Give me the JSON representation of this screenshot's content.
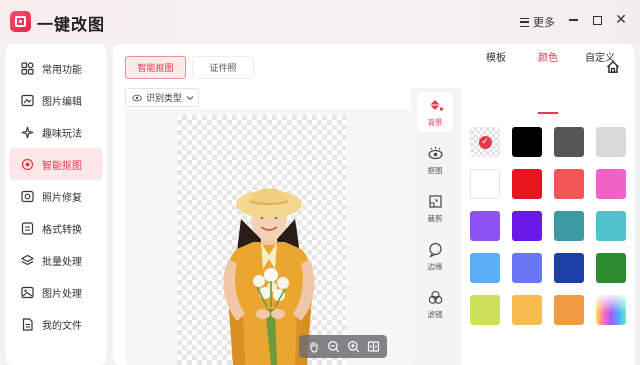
{
  "app": {
    "title": "一键改图",
    "more_label": "更多"
  },
  "sidebar": {
    "items": [
      {
        "label": "常用功能",
        "icon": "grid-icon"
      },
      {
        "label": "图片编辑",
        "icon": "image-edit-icon"
      },
      {
        "label": "趣味玩法",
        "icon": "sparkle-icon"
      },
      {
        "label": "智能抠图",
        "icon": "cutout-icon",
        "active": true
      },
      {
        "label": "照片修复",
        "icon": "repair-icon"
      },
      {
        "label": "格式转换",
        "icon": "convert-icon"
      },
      {
        "label": "批量处理",
        "icon": "layers-icon"
      },
      {
        "label": "图片处理",
        "icon": "picture-icon"
      },
      {
        "label": "我的文件",
        "icon": "file-icon"
      }
    ]
  },
  "main": {
    "tabs": [
      {
        "label": "智能抠图",
        "active": true
      },
      {
        "label": "证件照",
        "active": false
      }
    ],
    "recognize_label": "识别类型"
  },
  "tools": [
    {
      "label": "背景",
      "active": true
    },
    {
      "label": "抠图"
    },
    {
      "label": "裁剪"
    },
    {
      "label": "边缘"
    },
    {
      "label": "滤镜"
    }
  ],
  "panel": {
    "tabs": [
      {
        "label": "模板"
      },
      {
        "label": "颜色",
        "active": true
      },
      {
        "label": "自定义"
      }
    ],
    "colors": [
      "transparent",
      "#000000",
      "#555555",
      "#d9d9d9",
      "#ffffff",
      "#e8141e",
      "#f25555",
      "#f062c8",
      "#8f52f2",
      "#6a18e8",
      "#3a9a9f",
      "#4ec3cc",
      "#5aaef8",
      "#6a78f5",
      "#1c3fa8",
      "#2e8a2e",
      "#cfe158",
      "#f8bd4e",
      "#f09a42",
      "rainbow"
    ]
  },
  "accent": "#e23a4c"
}
